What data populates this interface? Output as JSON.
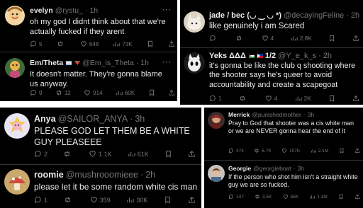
{
  "tweets": [
    {
      "name": "evelyn",
      "handle": "@rystu_",
      "time": "1h",
      "text": "oh my god I didnt think about that we're actually fucked if they arent",
      "replies": "5",
      "reposts": "",
      "likes": "648",
      "views": "73K"
    },
    {
      "name": "Em/Theta",
      "handle": "@Em_is_Theta",
      "time": "1h",
      "text": "It doesn't matter. They're gonna blame us anyway.",
      "replies": "9",
      "reposts": "12",
      "likes": "914",
      "views": "60K"
    },
    {
      "name": "jade / bec (◡ ‿ ◡ *)",
      "handle": "@decayingFeline",
      "time": "2h",
      "text": "like genuinely i am Scared",
      "replies": "",
      "reposts": "",
      "likes": "4",
      "views": "2.8K"
    },
    {
      "name": "Yeks ΔΔΔ",
      "handle": "@Y_e_k_s",
      "time": "2h",
      "extra": "1/2",
      "text": "it's gonna be like the club q shooting where the shooter says he's queer to avoid accountability and create a scapegoat",
      "replies": "1",
      "reposts": "",
      "likes": "4",
      "views": "2K"
    },
    {
      "name": "Anya",
      "handle": "@SAILOR_ANYA",
      "time": "3h",
      "text": "PLEASE GOD LET THEM BE A WHITE GUY PLEASEEE",
      "replies": "2",
      "reposts": "",
      "likes": "1.1K",
      "views": "61K"
    },
    {
      "name": "roomie",
      "handle": "@mushrooomieee",
      "time": "2h",
      "text": "please let it be some random white cis man",
      "replies": "1",
      "reposts": "",
      "likes": "359",
      "views": "30K"
    },
    {
      "name": "Merrick",
      "handle": "@punishedmother",
      "time": "3h",
      "text": "Pray to God that shooter was a cis white man or we are NEVER gonna hear the end of it",
      "replies": "474",
      "reposts": "6.7K",
      "likes": "107K",
      "views": "2.1M"
    },
    {
      "name": "Georgie",
      "handle": "@georgieboat",
      "time": "3h",
      "text": "If the person who shot him isn't a straight white guy we are so fucked.",
      "replies": "147",
      "reposts": "3.5K",
      "likes": "85K",
      "views": "1.1M"
    }
  ],
  "ui": {
    "dot": "·",
    "more": "···"
  },
  "colors": {
    "background": "#000000",
    "text": "#e7e9ea",
    "muted": "#71767b",
    "divider": "#2f3336"
  }
}
